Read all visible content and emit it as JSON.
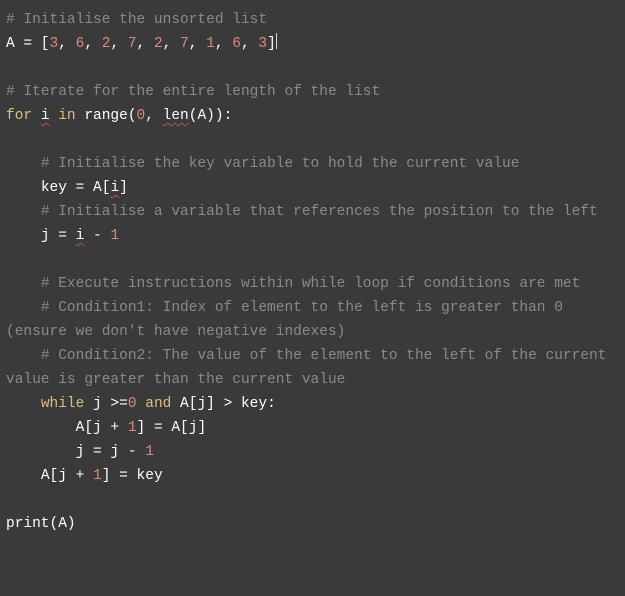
{
  "lines": {
    "c1": "# Initialise the unsorted list",
    "l2_var": "A",
    "l2_a": " = [",
    "l2_n1": "3",
    "l2_c1": ", ",
    "l2_n2": "6",
    "l2_c2": ", ",
    "l2_n3": "2",
    "l2_c3": ", ",
    "l2_n4": "7",
    "l2_c4": ", ",
    "l2_n5": "2",
    "l2_c5": ", ",
    "l2_n6": "7",
    "l2_c6": ", ",
    "l2_n7": "1",
    "l2_c7": ", ",
    "l2_n8": "6",
    "l2_c8": ", ",
    "l2_n9": "3",
    "l2_b": "]",
    "c3": "# Iterate for the entire length of the list",
    "l4_for": "for",
    "l4_i": "i",
    "l4_in": "in",
    "l4_range": "range",
    "l4_po": "(",
    "l4_z": "0",
    "l4_cm": ", ",
    "l4_len": "len",
    "l4_pa": "(A)):",
    "c5": "# Initialise the key variable to hold the current value",
    "l6_key": "key",
    "l6_eq": " = A[",
    "l6_i": "i",
    "l6_br": "]",
    "c7": "# Initialise a variable that references the position to the left",
    "l8_j": "j",
    "l8_eq": " = ",
    "l8_i": "i",
    "l8_m": " - ",
    "l8_one": "1",
    "c9": "# Execute instructions within while loop if conditions are met",
    "c10": "# Condition1: Index of element to the left is greater than 0 (ensure we don't have negative indexes)",
    "c11": "# Condition2: The value of the element to the left of the current value is greater than the current value",
    "l12_while": "while",
    "l12_a": " j >=",
    "l12_z": "0",
    "l12_and": "and",
    "l12_b": " A[j] > key:",
    "l13_a": "A[j + ",
    "l13_one": "1",
    "l13_b": "] = A[j]",
    "l14_a": "j = j - ",
    "l14_one": "1",
    "l15_a": "A[j + ",
    "l15_one": "1",
    "l15_b": "] = key",
    "l16_print": "print",
    "l16_p": "(A)"
  },
  "chart_data": {
    "type": "table",
    "title": "Insertion sort Python source code",
    "language": "python",
    "source": "# Initialise the unsorted list\nA = [3, 6, 2, 7, 2, 7, 1, 6, 3]\n\n# Iterate for the entire length of the list\nfor i in range(0, len(A)):\n\n    # Initialise the key variable to hold the current value\n    key = A[i]\n    # Initialise a variable that references the position to the left\n    j = i - 1\n\n    # Execute instructions within while loop if conditions are met\n    # Condition1: Index of element to the left is greater than 0 (ensure we don't have negative indexes)\n    # Condition2: The value of the element to the left of the current value is greater than the current value\n    while j >=0 and A[j] > key:\n        A[j + 1] = A[j]\n        j = j - 1\n    A[j + 1] = key\n\nprint(A)"
  }
}
